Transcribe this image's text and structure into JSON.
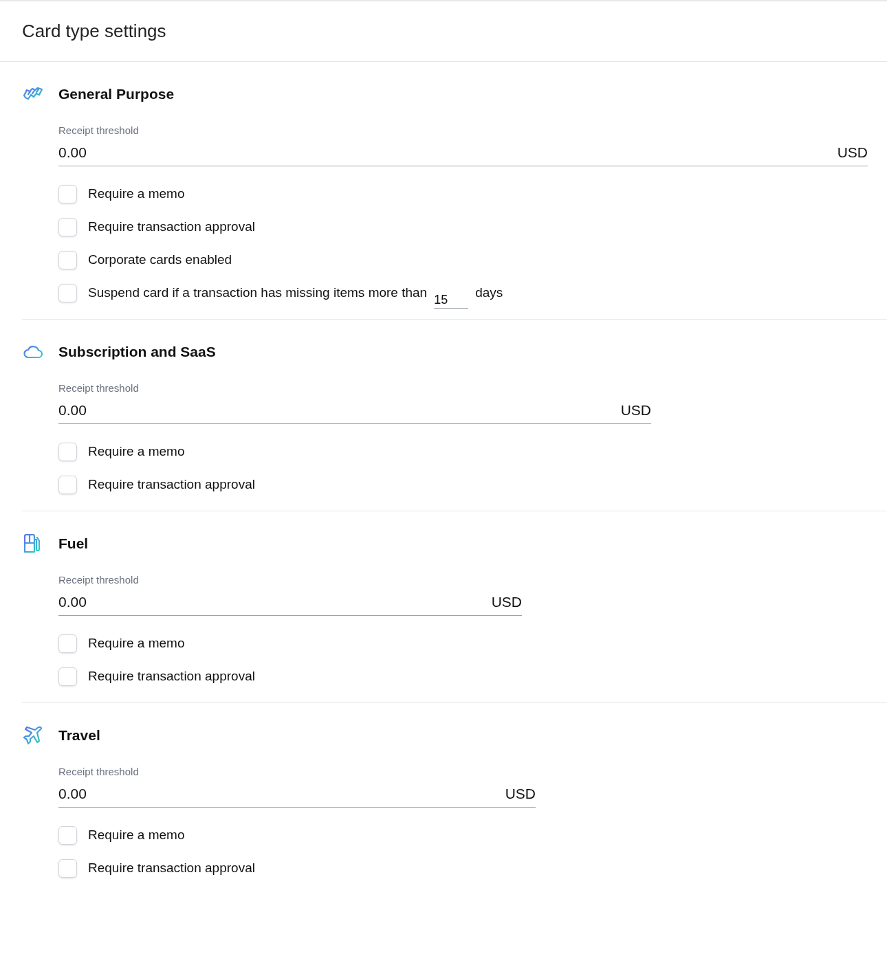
{
  "title": "Card type settings",
  "sections": [
    {
      "kind": "general",
      "name": "General Purpose",
      "threshold_label": "Receipt threshold",
      "threshold_value": "0.00",
      "currency": "USD",
      "options": [
        {
          "kind": "checkbox",
          "label": "Require a memo",
          "checked": false
        },
        {
          "kind": "checkbox",
          "label": "Require transaction approval",
          "checked": false
        },
        {
          "kind": "checkbox",
          "label": "Corporate cards enabled",
          "checked": false
        },
        {
          "kind": "days",
          "label": "Suspend card if a transaction has missing items more than",
          "value": "15",
          "suffix": "days",
          "checked": false
        }
      ]
    },
    {
      "kind": "subscription",
      "name": "Subscription and SaaS",
      "threshold_label": "Receipt threshold",
      "threshold_value": "0.00",
      "currency": "USD",
      "options": [
        {
          "kind": "checkbox",
          "label": "Require a memo",
          "checked": false
        },
        {
          "kind": "checkbox",
          "label": "Require transaction approval",
          "checked": false
        }
      ]
    },
    {
      "kind": "fuel",
      "name": "Fuel",
      "threshold_label": "Receipt threshold",
      "threshold_value": "0.00",
      "currency": "USD",
      "options": [
        {
          "kind": "checkbox",
          "label": "Require a memo",
          "checked": false
        },
        {
          "kind": "checkbox",
          "label": "Require transaction approval",
          "checked": false
        }
      ]
    },
    {
      "kind": "travel",
      "name": "Travel",
      "threshold_label": "Receipt threshold",
      "threshold_value": "0.00",
      "currency": "USD",
      "options": [
        {
          "kind": "checkbox",
          "label": "Require a memo",
          "checked": false
        },
        {
          "kind": "checkbox",
          "label": "Require transaction approval",
          "checked": false
        }
      ]
    }
  ]
}
